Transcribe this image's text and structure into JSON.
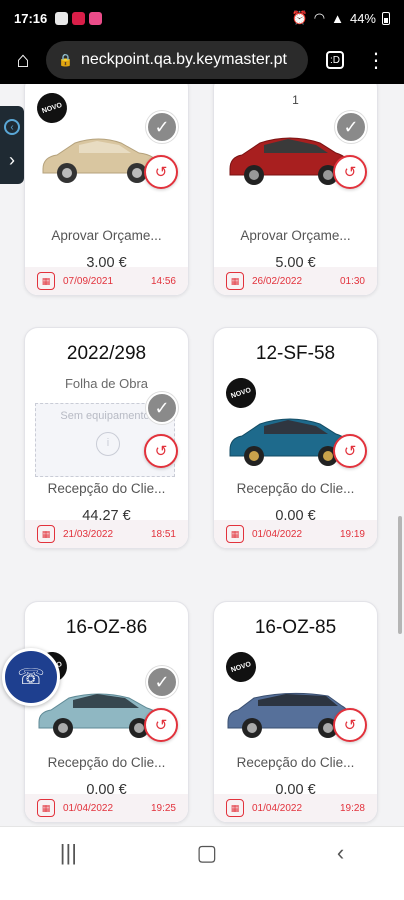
{
  "status_bar": {
    "time": "17:16",
    "battery": "44%",
    "app_icon_colors": [
      "#e8e8e8",
      "#d91e48",
      "#ea4c89"
    ]
  },
  "browser": {
    "url": "neckpoint.qa.by.keymaster.pt",
    "tab_count": ":D"
  },
  "cards": [
    {
      "plate": "",
      "subtype": "",
      "extra_number": "",
      "novo": "NOVO",
      "status": "Aprovar Orçame...",
      "amount": "3,00 €",
      "date": "07/09/2021",
      "time": "14:56",
      "car_color": "#d9c6a0",
      "has_check": true
    },
    {
      "plate": "",
      "subtype": "",
      "extra_number": "1",
      "novo": "",
      "status": "Aprovar Orçame...",
      "amount": "5,00 €",
      "date": "26/02/2022",
      "time": "01:30",
      "car_color": "#a81f1f",
      "has_check": true
    },
    {
      "plate": "2022/298",
      "subtype": "Folha de Obra",
      "extra_number": "",
      "novo": "",
      "no_equipment": "Sem equipamento",
      "status": "Recepção do Clie...",
      "amount": "44,27 €",
      "date": "21/03/2022",
      "time": "18:51",
      "car_color": "",
      "has_check": true
    },
    {
      "plate": "12-SF-58",
      "subtype": "",
      "extra_number": "",
      "novo": "NOVO",
      "status": "Recepção do Clie...",
      "amount": "0,00 €",
      "date": "01/04/2022",
      "time": "19:19",
      "car_color": "#1e6a8c",
      "has_check": false
    },
    {
      "plate": "16-OZ-86",
      "subtype": "",
      "extra_number": "",
      "novo": "NOVO",
      "status": "Recepção do Clie...",
      "amount": "0,00 €",
      "date": "01/04/2022",
      "time": "19:25",
      "car_color": "#8fb7c2",
      "has_check": true
    },
    {
      "plate": "16-OZ-85",
      "subtype": "",
      "extra_number": "",
      "novo": "NOVO",
      "status": "Recepção do Clie...",
      "amount": "0,00 €",
      "date": "01/04/2022",
      "time": "19:28",
      "car_color": "#56709a",
      "has_check": false
    }
  ],
  "colors": {
    "accent": "#e2323c",
    "support_button": "#1e3f8f",
    "side_tab": "#1f2a33"
  }
}
